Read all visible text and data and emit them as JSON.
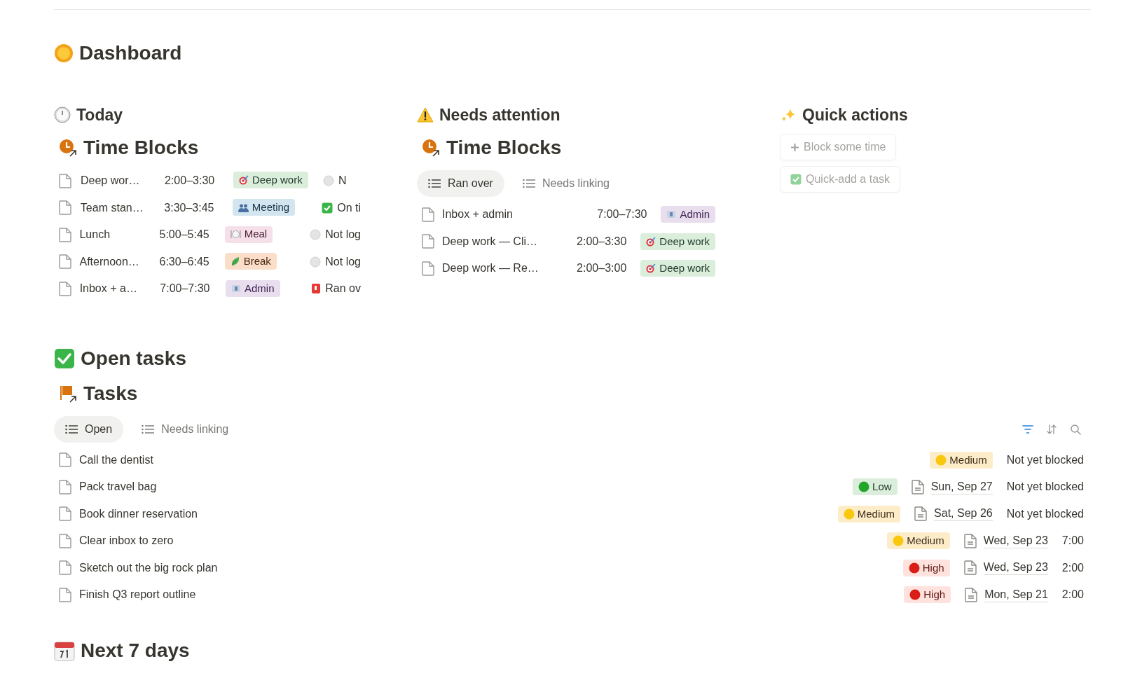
{
  "title": "Dashboard",
  "today": {
    "heading": "Today",
    "database": "Time Blocks",
    "rows": [
      {
        "name": "Deep wor…",
        "time": "2:00–3:30",
        "tag": {
          "label": "Deep work",
          "kind": "deep_work"
        },
        "status": {
          "label": "N",
          "kind": "not_logged"
        }
      },
      {
        "name": "Team stan…",
        "time": "3:30–3:45",
        "tag": {
          "label": "Meeting",
          "kind": "meeting"
        },
        "status": {
          "label": "On ti",
          "kind": "on_time"
        }
      },
      {
        "name": "Lunch",
        "time": "5:00–5:45",
        "tag": {
          "label": "Meal",
          "kind": "meal"
        },
        "status": {
          "label": "Not log",
          "kind": "not_logged"
        }
      },
      {
        "name": "Afternoon…",
        "time": "6:30–6:45",
        "tag": {
          "label": "Break",
          "kind": "break"
        },
        "status": {
          "label": "Not log",
          "kind": "not_logged"
        }
      },
      {
        "name": "Inbox + a…",
        "time": "7:00–7:30",
        "tag": {
          "label": "Admin",
          "kind": "admin"
        },
        "status": {
          "label": "Ran ov",
          "kind": "ran_over"
        }
      }
    ]
  },
  "needs_attention": {
    "heading": "Needs attention",
    "database": "Time Blocks",
    "tabs": [
      {
        "label": "Ran over",
        "selected": true
      },
      {
        "label": "Needs linking",
        "selected": false
      }
    ],
    "rows": [
      {
        "name": "Inbox + admin",
        "time": "7:00–7:30",
        "tag": {
          "label": "Admin",
          "kind": "admin"
        }
      },
      {
        "name": "Deep work — Cli…",
        "time": "2:00–3:30",
        "tag": {
          "label": "Deep work",
          "kind": "deep_work"
        }
      },
      {
        "name": "Deep work — Re…",
        "time": "2:00–3:00",
        "tag": {
          "label": "Deep work",
          "kind": "deep_work"
        }
      }
    ]
  },
  "quick_actions": {
    "heading": "Quick actions",
    "buttons": [
      {
        "label": "Block some time",
        "kind": "plus"
      },
      {
        "label": "Quick-add a task",
        "kind": "check"
      }
    ]
  },
  "open_tasks": {
    "heading": "Open tasks",
    "database": "Tasks",
    "tabs": [
      {
        "label": "Open",
        "selected": true
      },
      {
        "label": "Needs linking",
        "selected": false
      }
    ],
    "rows": [
      {
        "name": "Call the dentist",
        "priority": {
          "label": "Medium",
          "kind": "medium"
        },
        "block": "Not yet blocked"
      },
      {
        "name": "Pack travel bag",
        "priority": {
          "label": "Low",
          "kind": "low"
        },
        "date": "Sun, Sep 27",
        "block": "Not yet blocked"
      },
      {
        "name": "Book dinner reservation",
        "priority": {
          "label": "Medium",
          "kind": "medium"
        },
        "date": "Sat, Sep 26",
        "block": "Not yet blocked"
      },
      {
        "name": "Clear inbox to zero",
        "priority": {
          "label": "Medium",
          "kind": "medium"
        },
        "date": "Wed, Sep 23",
        "block": "7:00"
      },
      {
        "name": "Sketch out the big rock plan",
        "priority": {
          "label": "High",
          "kind": "high"
        },
        "date": "Wed, Sep 23",
        "block": "2:00"
      },
      {
        "name": "Finish Q3 report outline",
        "priority": {
          "label": "High",
          "kind": "high"
        },
        "date": "Mon, Sep 21",
        "block": "2:00"
      }
    ]
  },
  "next_days": {
    "heading": "Next 7 days"
  }
}
